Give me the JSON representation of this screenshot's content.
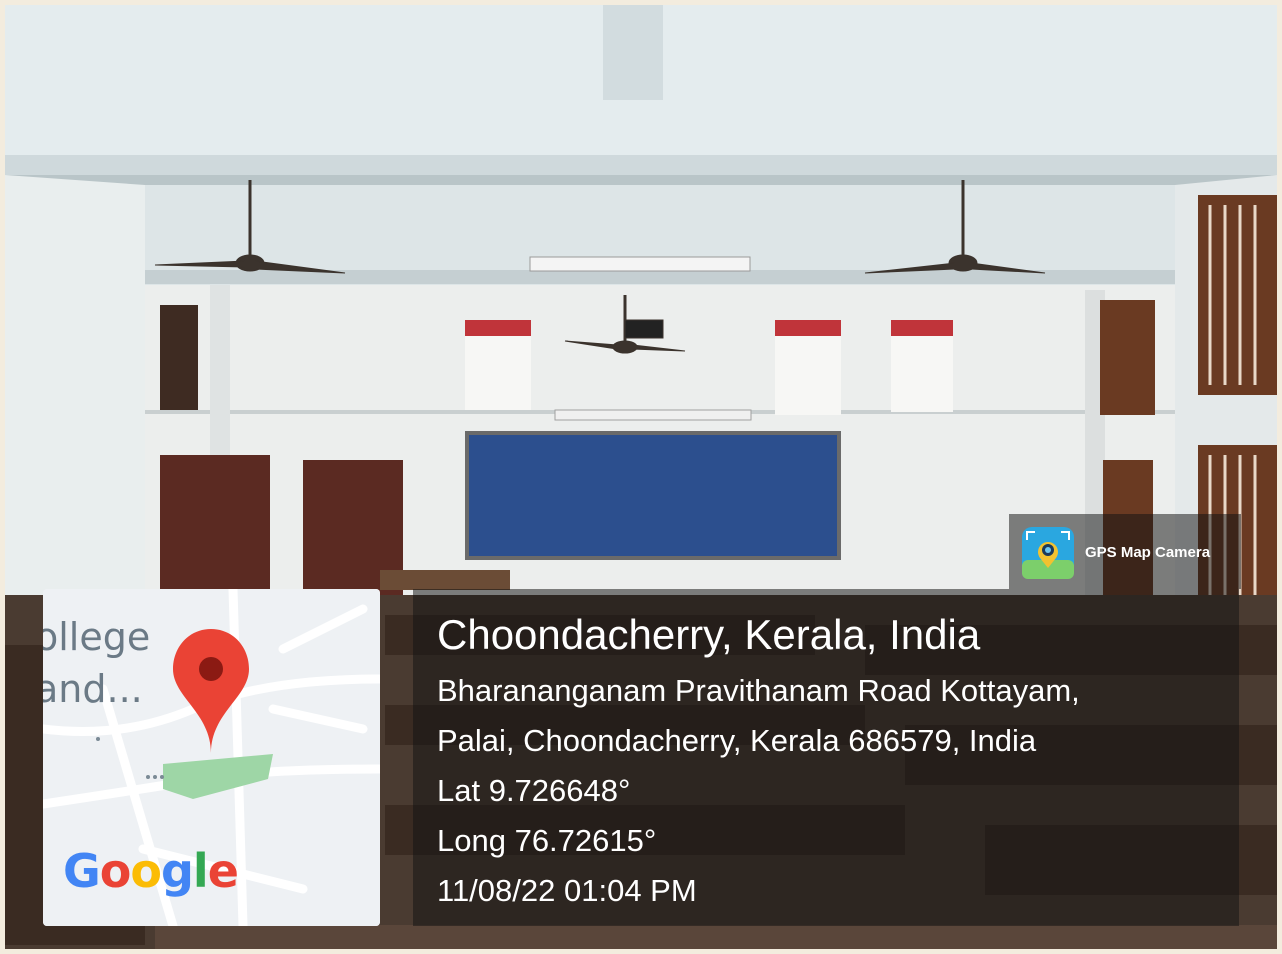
{
  "map": {
    "label_line1": "ollege",
    "label_line2": "and...",
    "google_letters": [
      {
        "ch": "G",
        "color": "#4285F4"
      },
      {
        "ch": "o",
        "color": "#EA4335"
      },
      {
        "ch": "o",
        "color": "#FBBC05"
      },
      {
        "ch": "g",
        "color": "#4285F4"
      },
      {
        "ch": "l",
        "color": "#34A853"
      },
      {
        "ch": "e",
        "color": "#EA4335"
      }
    ],
    "pin_color": "#EA4335",
    "pin_dot_color": "#8B1A13",
    "park_color": "#9ED6A6"
  },
  "overlay": {
    "place": "Choondacherry, Kerala, India",
    "address_line1": "Bharananganam Pravithanam Road Kottayam,",
    "address_line2": "Palai, Choondacherry, Kerala 686579, India",
    "latitude": "Lat 9.726648°",
    "longitude": "Long 76.72615°",
    "datetime": "11/08/22 01:04 PM"
  },
  "app_badge": {
    "name": "GPS Map Camera",
    "icon": "gps-map-camera-app-icon"
  },
  "scene": {
    "description_icon": "classroom-photo",
    "blackboard_color": "#2c4f8e",
    "door_color": "#5b2a22",
    "poster_accent": "#c0343a"
  }
}
